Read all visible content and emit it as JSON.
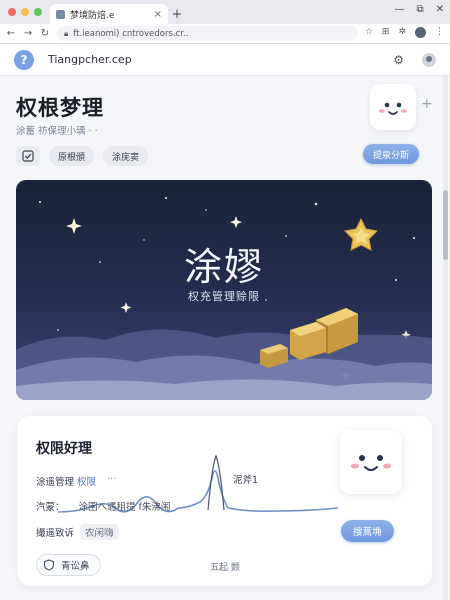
{
  "browser": {
    "tab_title": "梦境防焙.e",
    "tab_close": "×",
    "new_tab": "+",
    "url": "ft.ieanomi) cntrovedors.cr..",
    "window_controls": [
      "—",
      "⧉",
      "✕"
    ]
  },
  "header": {
    "help_label": "?",
    "app_name": "Tiangpcher.cep"
  },
  "page": {
    "title": "权根梦理",
    "subtitle": "涂蓄 祊保理小瑀  ·  ·",
    "chips": [
      "原根頒",
      "涂庑窦"
    ],
    "primary_button": "提泉分斯"
  },
  "hero": {
    "title": "涂嫪",
    "subtitle": "权充管理赊限"
  },
  "card": {
    "title": "权限好理",
    "row1_label": "涂遥管理",
    "row1_highlight": "权限",
    "row1_dots": "···",
    "peak_label": "泥斧1",
    "row2_label": "汽蒙：",
    "row2_overlay": "涂圉へ遇租提 f朱沸闱",
    "row3_label": "撮遥致诉",
    "row3_tag": "农闲嗨",
    "action_button": "搜蒿埆",
    "shield_button": "青讼鼻",
    "footer_text": "五起  颤"
  },
  "colors": {
    "accent": "#7aa1e6",
    "hero_top": "#1a2139",
    "hero_bottom": "#3c4677",
    "gold": "#e6bd58"
  }
}
